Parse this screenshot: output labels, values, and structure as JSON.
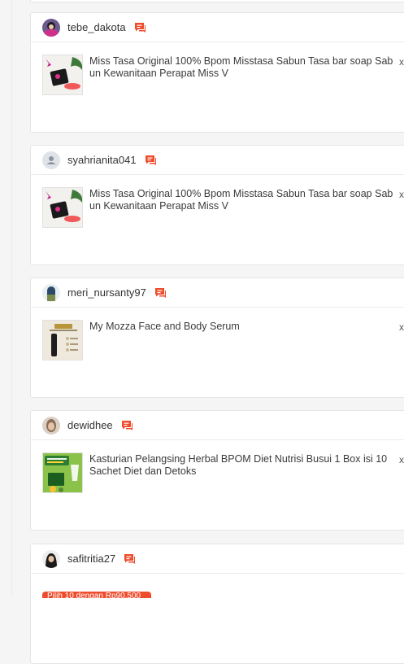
{
  "colors": {
    "accent": "#ee4d2d",
    "border": "#e5e5e5",
    "background": "#f5f5f5"
  },
  "orders": [
    {
      "username": "tebe_dakota",
      "avatar_icon": "user-photo-avatar",
      "chat_icon": "chat-icon",
      "product_title": "Miss Tasa Original 100% Bpom Misstasa Sabun Tasa bar soap Sabun Kewanitaan Perapat Miss V",
      "quantity": "x"
    },
    {
      "username": "syahrianita041",
      "avatar_icon": "default-user-icon",
      "chat_icon": "chat-icon",
      "product_title": "Miss Tasa Original 100% Bpom Misstasa Sabun Tasa bar soap Sabun Kewanitaan Perapat Miss V",
      "quantity": "x"
    },
    {
      "username": "meri_nursanty97",
      "avatar_icon": "user-photo-avatar",
      "chat_icon": "chat-icon",
      "product_title": "My Mozza Face and Body Serum",
      "quantity": "x"
    },
    {
      "username": "dewidhee",
      "avatar_icon": "user-photo-avatar",
      "chat_icon": "chat-icon",
      "product_title": "Kasturian Pelangsing Herbal BPOM Diet Nutrisi Busui 1 Box isi 10 Sachet Diet dan Detoks",
      "quantity": "x"
    },
    {
      "username": "safitritia27",
      "avatar_icon": "user-photo-avatar",
      "chat_icon": "chat-icon",
      "promo_label": "Pilih 10 dengan Rp90.500"
    }
  ]
}
